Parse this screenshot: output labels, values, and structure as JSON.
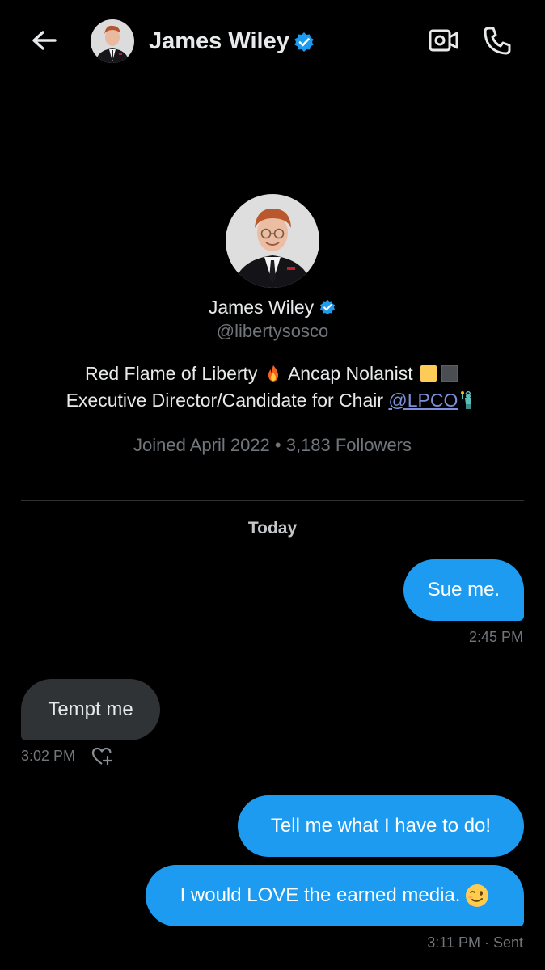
{
  "header": {
    "name": "James Wiley",
    "back_icon": "arrow-left-icon",
    "video_icon": "video-call-icon",
    "call_icon": "phone-icon",
    "verified_icon": "verified-badge-icon"
  },
  "profile": {
    "name": "James Wiley",
    "handle": "@libertysosco",
    "bio_line1_a": "Red Flame of Liberty",
    "bio_line1_b": "Ancap Nolanist",
    "bio_line2_a": "Executive Director/Candidate for Chair",
    "bio_line2_link": "@LPCO",
    "joined": "Joined April 2022 • 3,183 Followers"
  },
  "thread": {
    "day_label": "Today",
    "messages": [
      {
        "direction": "out",
        "text": "Sue me.",
        "time": "2:45 PM"
      },
      {
        "direction": "in",
        "text": "Tempt me",
        "time": "3:02 PM"
      },
      {
        "direction": "out",
        "text": "Tell me what I have to do!"
      },
      {
        "direction": "out",
        "text": "I would LOVE the earned media.",
        "time": "3:11 PM · Sent"
      }
    ]
  },
  "colors": {
    "accent": "#1d9bf0",
    "incoming_bubble": "#2f3336",
    "background": "#000000",
    "secondary_text": "#71767b"
  }
}
